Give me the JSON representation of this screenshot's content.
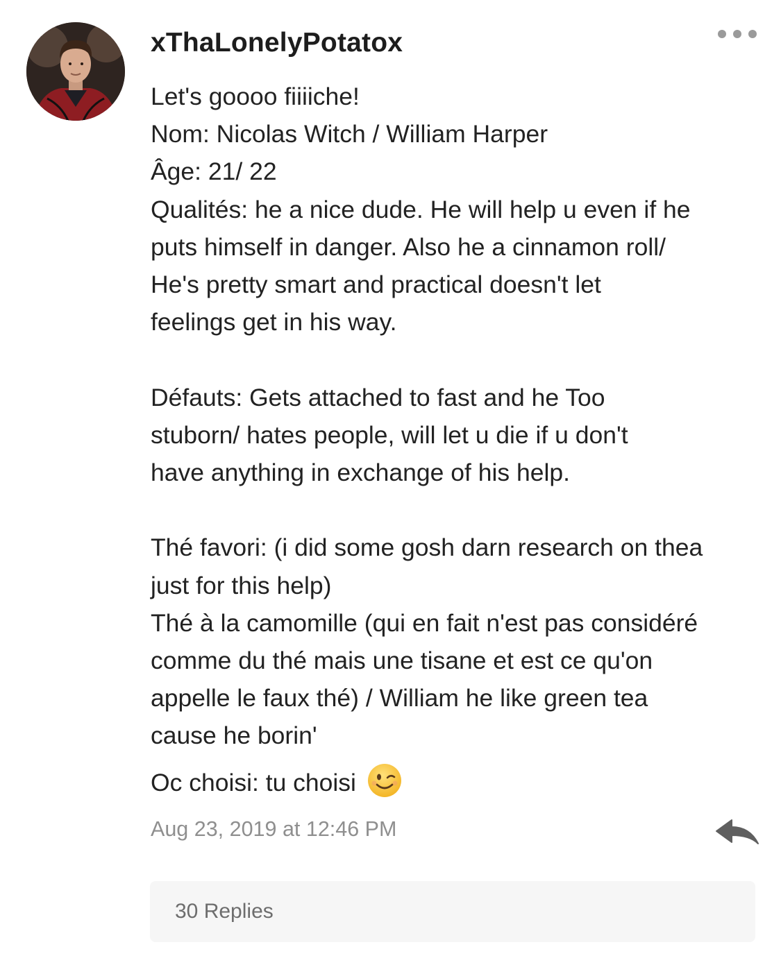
{
  "comment": {
    "username": "xThaLonelyPotatox",
    "avatar": {
      "icon": "user-avatar"
    },
    "more_icon": "more-horizontal-icon",
    "body_lines": [
      "Let's goooo fiiiiche!",
      "Nom: Nicolas Witch / William Harper",
      "Âge: 21/ 22",
      "Qualités: he a nice dude. He will help u even if he",
      "puts himself in danger. Also he a cinnamon roll/",
      "He's pretty smart and practical doesn't let",
      "feelings get in his way.",
      "",
      "Défauts: Gets attached to fast and he Too",
      "stuborn/ hates people, will let u die if u don't",
      "have anything in exchange of his help.",
      "",
      "Thé favori: (i did some gosh darn research on thea",
      "just for this help)",
      "Thé à la camomille (qui en fait n'est pas considéré",
      "comme du thé mais une tisane et est ce qu'on",
      "appelle le faux thé) / William he like green tea",
      "cause he borin'"
    ],
    "oc_line": "Oc choisi: tu choisi",
    "oc_emoji": "winking-face-emoji",
    "timestamp": "Aug 23, 2019 at 12:46 PM",
    "reply_icon": "reply-arrow-icon",
    "replies_label": "30 Replies"
  },
  "colors": {
    "text": "#222222",
    "meta_text": "#8f8f8f",
    "icon_gray": "#9a9a9a",
    "reply_icon": "#5f5f5f",
    "replies_bg": "#f6f6f6",
    "emoji_yellow": "#f7c33c"
  }
}
